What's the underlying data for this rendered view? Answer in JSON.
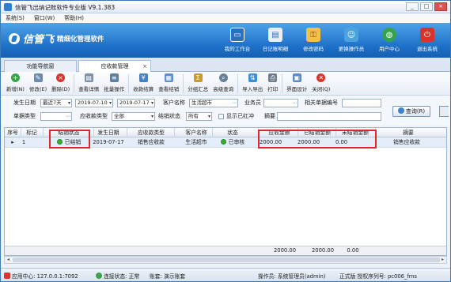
{
  "window": {
    "title": "信管飞出纳记账软件专业版 V9.1.383",
    "buttons": [
      "_",
      "□",
      "×"
    ]
  },
  "menu": [
    "系统(S)",
    "窗口(W)",
    "帮助(H)"
  ],
  "header": {
    "logo_text": "信管飞",
    "logo_sub": "精细化管理软件",
    "nav": [
      {
        "label": "我的工作台",
        "icon": "monitor-icon",
        "color": "#2b6fbf"
      },
      {
        "label": "日记账明细",
        "icon": "ledger-icon",
        "color": "#3b8be0"
      },
      {
        "label": "修改密码",
        "icon": "password-icon",
        "color": "#e4a22b"
      },
      {
        "label": "更换操作员",
        "icon": "switch-user-icon",
        "color": "#4aa3df"
      },
      {
        "label": "用户中心",
        "icon": "globe-icon",
        "color": "#37a24c"
      },
      {
        "label": "退出系统",
        "icon": "power-icon",
        "color": "#d9342b"
      }
    ]
  },
  "tabs": [
    {
      "label": "功能导航窗"
    },
    {
      "label": "应收款管理",
      "close": "×"
    }
  ],
  "toolbar": [
    {
      "label": "新增(N)",
      "icon": "add-icon",
      "color": "#3da24a"
    },
    {
      "label": "修改(E)",
      "icon": "edit-icon",
      "color": "#6a8cb3"
    },
    {
      "label": "删除(D)",
      "icon": "delete-icon",
      "color": "#d9342b"
    },
    {
      "label": "查看详情",
      "icon": "detail-icon",
      "color": "#7a8fa8"
    },
    {
      "label": "批量操作",
      "icon": "batch-icon",
      "color": "#5c7fa6"
    },
    {
      "label": "收款结算",
      "icon": "settle-icon",
      "color": "#4a7fc0"
    },
    {
      "label": "查看结销",
      "icon": "view-settle-icon",
      "color": "#5e8fc6"
    },
    {
      "label": "分组汇总",
      "icon": "group-sum-icon",
      "color": "#c99a2e"
    },
    {
      "label": "高级查询",
      "icon": "advanced-search-icon",
      "color": "#6a7f98"
    },
    {
      "label": "导入导出",
      "icon": "import-export-icon",
      "color": "#3b8fd6"
    },
    {
      "label": "打印",
      "icon": "print-icon",
      "color": "#6f7c8c"
    },
    {
      "label": "界面设计",
      "icon": "design-icon",
      "color": "#5b8ac6"
    },
    {
      "label": "关闭(Q)",
      "icon": "close-circle-icon",
      "color": "#d9342b"
    }
  ],
  "filters": {
    "date_label": "发生日期",
    "date_range": "最近7天",
    "date_from": "2019-07-10",
    "date_to": "2019-07-17",
    "customer_label": "客户名称",
    "customer_value": "生活超市",
    "clerk_label": "业务员",
    "clerk_value": "",
    "docno_label": "相关单据编号",
    "docno_value": "",
    "doctype_label": "单据类型",
    "doctype_value": "",
    "ar_type_label": "应收款类型",
    "ar_type_value": "全部",
    "settle_label": "结销状态",
    "settle_value": "所有",
    "show_red_label": "显示已红冲",
    "summary_label": "摘要",
    "summary_value": "",
    "query_button": "查询(R)"
  },
  "grid": {
    "columns": [
      "序号",
      "标记",
      "结销状态",
      "发生日期",
      "应收款类型",
      "客户名称",
      "状态",
      "应收金额",
      "已结销金额",
      "未结销金额",
      "摘要"
    ],
    "rows": [
      {
        "no": "1",
        "mark": "",
        "settle_status": "已结销",
        "date": "2019-07-17",
        "type": "销售应收款",
        "customer": "生活超市",
        "status": "已审核",
        "amount": "2000.00",
        "settled": "2000.00",
        "unsettled": "0.00",
        "summary": "销售应收款"
      }
    ],
    "totals": {
      "amount": "2000.00",
      "settled": "2000.00",
      "unsettled": "0.00"
    }
  },
  "statusbar": {
    "app_center": "应用中心: 127.0.0.1:7092",
    "connection": "连接状态: 正常",
    "account": "账套: 演示账套",
    "operator": "操作员: 系统管理员(admin)",
    "license": "正式版 授权序列号: pc006_fms"
  }
}
